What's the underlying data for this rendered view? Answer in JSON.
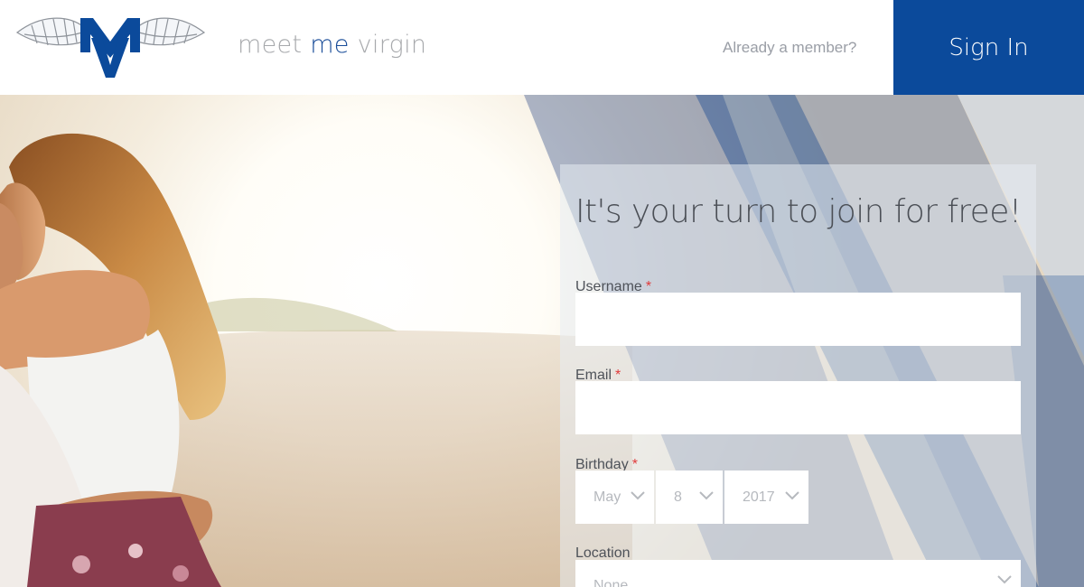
{
  "header": {
    "brand_parts": [
      "meet",
      "me",
      "virgin"
    ],
    "already_member": "Already a member?",
    "sign_in_label": "Sign In"
  },
  "form": {
    "title": "It's your turn to join for free!",
    "username": {
      "label": "Username",
      "required_mark": "*",
      "value": ""
    },
    "email": {
      "label": "Email",
      "required_mark": "*",
      "value": ""
    },
    "birthday": {
      "label": "Birthday",
      "required_mark": "*",
      "month": "May",
      "day": "8",
      "year": "2017"
    },
    "location": {
      "label": "Location",
      "selected": "None"
    }
  },
  "icons": [
    "winged-logo-icon",
    "chevron-down-icon"
  ],
  "colors": {
    "brand_blue": "#0b4a9b",
    "accent_text": "#1a4d99",
    "required_red": "#e03b3b"
  }
}
